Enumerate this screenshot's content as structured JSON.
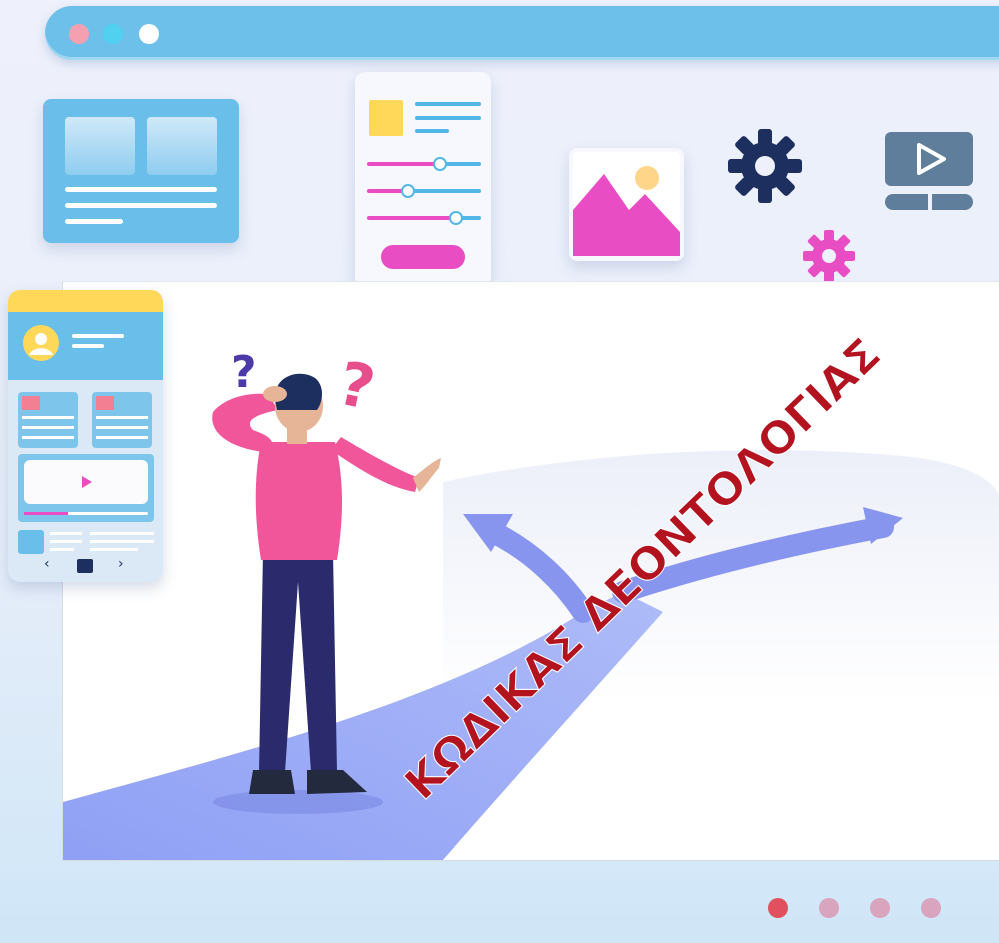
{
  "window": {
    "controls": [
      {
        "name": "close",
        "color": "#f4a0b0"
      },
      {
        "name": "minimize",
        "color": "#4fd1ef"
      },
      {
        "name": "maximize",
        "color": "#ffffff"
      }
    ]
  },
  "hero": {
    "banner_text": "ΚΩΔΙΚΑΣ ΔΕΟΝΤΟΛΟΓΙΑΣ",
    "question_mark_left": "?",
    "question_mark_right": "?"
  },
  "phone": {
    "nav_prev": "‹",
    "nav_next": "›"
  },
  "pagination": {
    "active_index": 0,
    "dots": [
      {
        "color": "#e0505e"
      },
      {
        "color": "#d8a4be"
      },
      {
        "color": "#d8a4be"
      },
      {
        "color": "#d8a4be"
      }
    ]
  },
  "colors": {
    "accent_blue": "#6cc0ea",
    "accent_pink": "#e84dc4",
    "accent_yellow": "#ffd85a",
    "dark_navy": "#1d2f5e",
    "banner_red": "#b3131f"
  }
}
